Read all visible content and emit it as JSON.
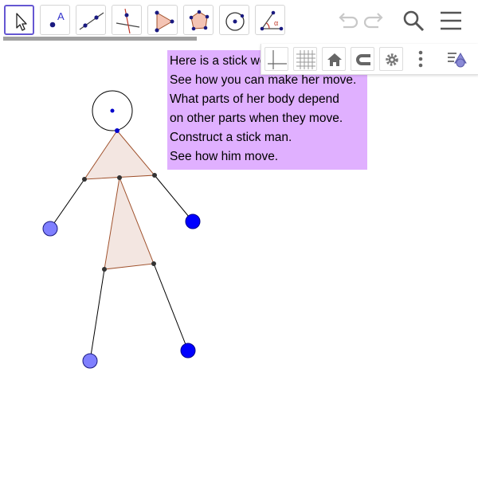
{
  "toolbar": {
    "tools": [
      {
        "name": "move-tool",
        "icon": "arrow-cursor-icon",
        "active": true
      },
      {
        "name": "point-tool",
        "icon": "point-label-icon",
        "label": "A"
      },
      {
        "name": "line-tool",
        "icon": "line-icon"
      },
      {
        "name": "perpendicular-line-tool",
        "icon": "perpendicular-line-icon"
      },
      {
        "name": "polygon-tool",
        "icon": "polygon-icon"
      },
      {
        "name": "regular-polygon-tool",
        "icon": "regular-polygon-icon"
      },
      {
        "name": "circle-tool",
        "icon": "circle-icon"
      },
      {
        "name": "angle-tool",
        "icon": "angle-icon",
        "label": "α"
      }
    ],
    "right": [
      "undo-icon",
      "redo-icon",
      "search-icon",
      "menu-icon"
    ]
  },
  "style_bar": {
    "buttons": [
      "axes-icon",
      "grid-icon",
      "home-icon",
      "magnet-icon",
      "settings-icon",
      "more-vertical-icon",
      "view-toggle-icon"
    ]
  },
  "text_box": {
    "background": "#e0b0ff",
    "lines": [
      "Here is a stick woman.",
      "See how you can make her move.",
      "What parts of her body depend",
      "on other parts when they move.",
      "Construct a stick man.",
      "See how him move."
    ]
  },
  "figure": {
    "head_fill": "#ffffff",
    "body_fill": "#f3e6e1",
    "body_stroke": "#a0522d",
    "limb_stroke": "#000000",
    "hand_fill_light": "#7f7fff",
    "hand_fill_dark": "#0000ff",
    "joint_fill": "#333333"
  }
}
